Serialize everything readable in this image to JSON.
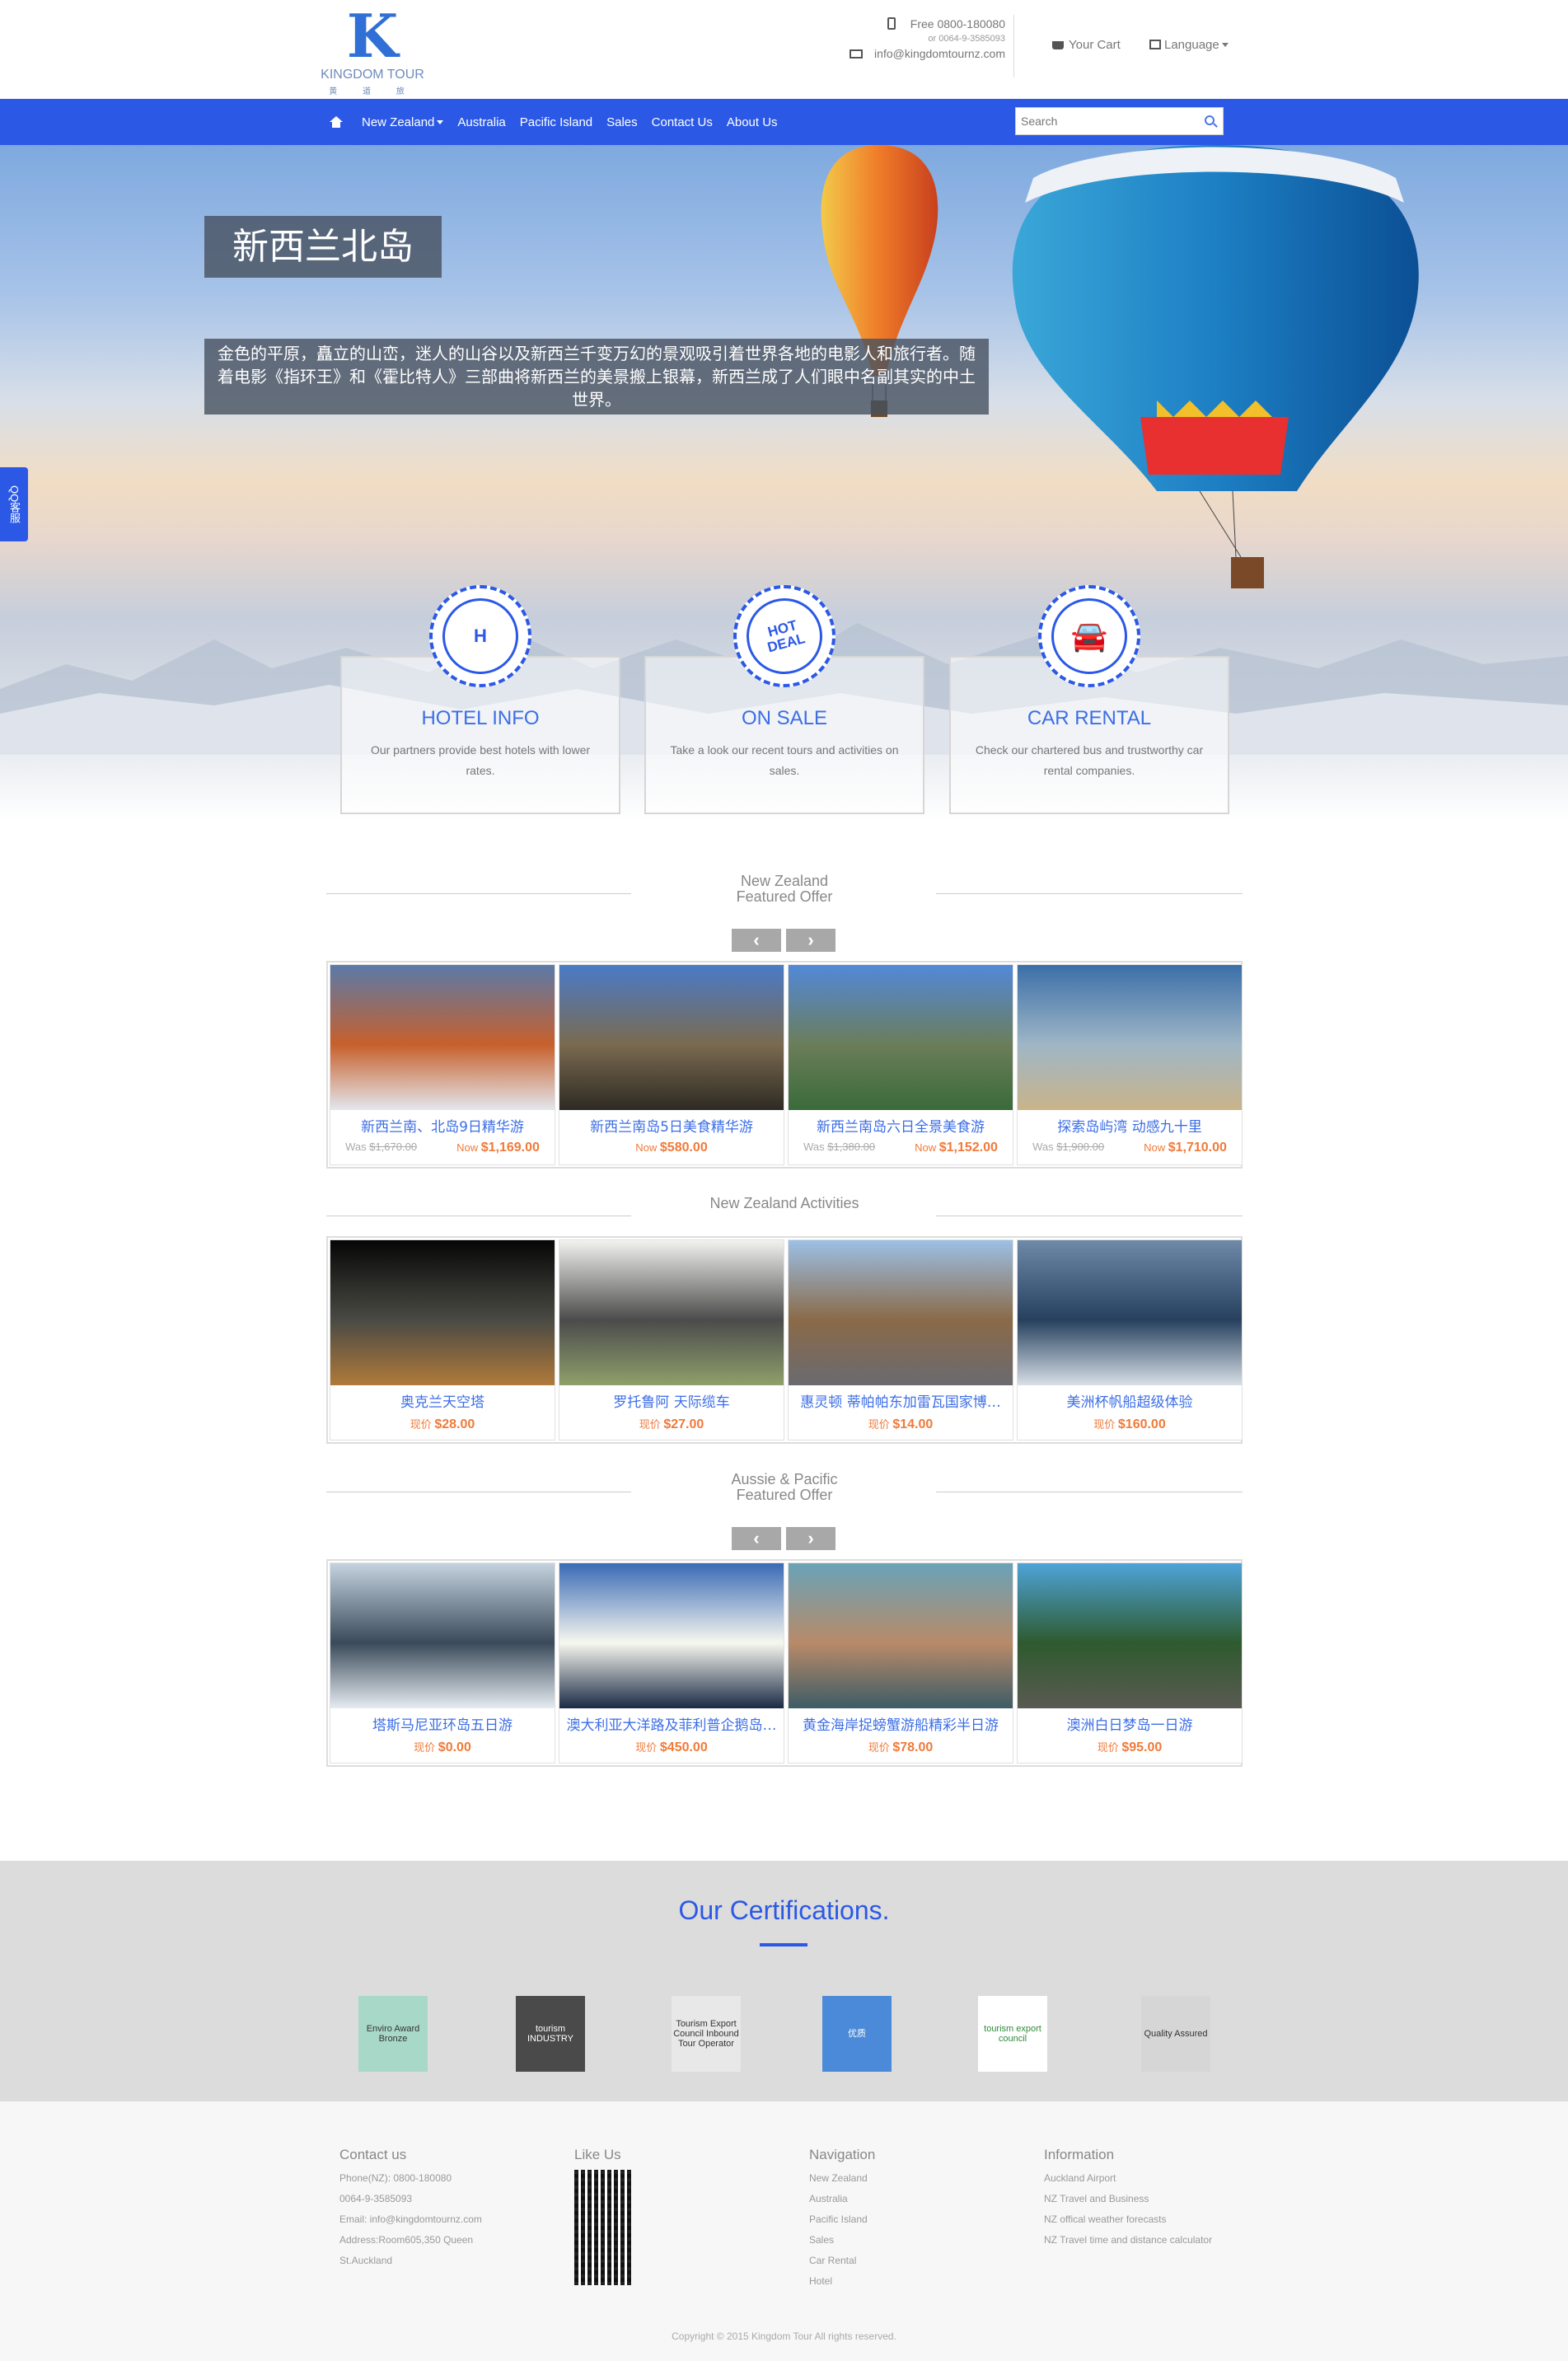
{
  "header": {
    "logo_mark": "K",
    "logo_name": "KINGDOM TOUR",
    "logo_sub": "黄 道 旅 游",
    "phone": "Free 0800-180080",
    "phone_alt": "or 0064-9-3585093",
    "email": "info@kingdomtournz.com",
    "cart": "Your Cart",
    "language": "Language"
  },
  "nav": {
    "items": [
      "New Zealand",
      "Australia",
      "Pacific Island",
      "Sales",
      "Contact Us",
      "About Us"
    ],
    "search_placeholder": "Search"
  },
  "hero": {
    "title": "新西兰北岛",
    "description": "金色的平原，矗立的山峦，迷人的山谷以及新西兰千变万幻的景观吸引着世界各地的电影人和旅行者。随着电影《指环王》和《霍比特人》三部曲将新西兰的美景搬上银幕，新西兰成了人们眼中名副其实的中土世界。",
    "qq_tab": "QQ客服"
  },
  "services": [
    {
      "icon": "hotel-icon",
      "badge": "H",
      "title": "HOTEL INFO",
      "desc": "Our partners provide best hotels with lower rates."
    },
    {
      "icon": "hot-deal-icon",
      "badge": "HOT DEAL",
      "title": "ON SALE",
      "desc": "Take a look our recent tours and activities on sales."
    },
    {
      "icon": "car-icon",
      "badge": "🚘",
      "title": "CAR RENTAL",
      "desc": "Check our chartered bus and trustworthy car rental companies."
    }
  ],
  "sections": {
    "featured_title": "New Zealand Featured Offer",
    "activities_title": "New Zealand Activities",
    "pacific_title": "Aussie & Pacific Featured Offer",
    "prev": "‹",
    "next": "›"
  },
  "featured": [
    {
      "title": "新西兰南、北岛9日精华游",
      "was": "$1,670.00",
      "now": "$1,169.00",
      "colors": [
        "#5a7aa8",
        "#c7602c",
        "#e4e7ee"
      ]
    },
    {
      "title": "新西兰南岛5日美食精华游",
      "was": "",
      "now": "$580.00",
      "colors": [
        "#4a7bc7",
        "#7a6a50",
        "#2e2a24"
      ]
    },
    {
      "title": "新西兰南岛六日全景美食游",
      "was": "$1,380.00",
      "now": "$1,152.00",
      "colors": [
        "#5289d8",
        "#6b7d5a",
        "#3a6b3a"
      ]
    },
    {
      "title": "探索岛屿湾 动感九十里",
      "was": "$1,900.00",
      "now": "$1,710.00",
      "colors": [
        "#3b6fa8",
        "#9fb6c6",
        "#c9b48a"
      ]
    }
  ],
  "activities": [
    {
      "title": "奥克兰天空塔",
      "label": "现价",
      "now": "$28.00",
      "colors": [
        "#060606",
        "#4a4a44",
        "#b07a3a"
      ]
    },
    {
      "title": "罗托鲁阿 天际缆车",
      "label": "现价",
      "now": "$27.00",
      "colors": [
        "#f2f2f0",
        "#4b4b4b",
        "#8fa06a"
      ]
    },
    {
      "title": "惠灵顿 蒂帕帕东加雷瓦国家博…",
      "label": "现价",
      "now": "$14.00",
      "colors": [
        "#9cc0e6",
        "#8a6a48",
        "#6a6a70"
      ]
    },
    {
      "title": "美洲杯帆船超级体验",
      "label": "现价",
      "now": "$160.00",
      "colors": [
        "#6e8aa8",
        "#26405e",
        "#d8dfe6"
      ]
    }
  ],
  "pacific": [
    {
      "title": "塔斯马尼亚环岛五日游",
      "label": "现价",
      "now": "$0.00",
      "colors": [
        "#c5d3e0",
        "#3a4a5a",
        "#e6ecf2"
      ]
    },
    {
      "title": "澳大利亚大洋路及菲利普企鹅岛…",
      "label": "现价",
      "now": "$450.00",
      "colors": [
        "#3a6ab5",
        "#f7f7ef",
        "#1a2a45"
      ]
    },
    {
      "title": "黄金海岸捉螃蟹游船精彩半日游",
      "label": "现价",
      "now": "$78.00",
      "colors": [
        "#6aa3b8",
        "#b88a68",
        "#3d5c66"
      ]
    },
    {
      "title": "澳洲白日梦岛一日游",
      "label": "现价",
      "now": "$95.00",
      "colors": [
        "#4ea3d8",
        "#2e5a2e",
        "#5a5a52"
      ]
    }
  ],
  "certifications": {
    "title": "Our Certifications.",
    "items": [
      {
        "label": "Enviro Award Bronze",
        "bg": "#a8d8c8",
        "fg": "#333"
      },
      {
        "label": "tourism INDUSTRY",
        "bg": "#4a4a4a",
        "fg": "#fff"
      },
      {
        "label": "Tourism Export Council Inbound Tour Operator",
        "bg": "#e8e8e8",
        "fg": "#333"
      },
      {
        "label": "优质",
        "bg": "#4a8ad8",
        "fg": "#fff"
      },
      {
        "label": "tourism export council",
        "bg": "#ffffff",
        "fg": "#2e8a3a"
      },
      {
        "label": "Quality Assured",
        "bg": "#d6d6d6",
        "fg": "#333"
      }
    ]
  },
  "footer": {
    "contact": {
      "title": "Contact us",
      "lines": [
        "Phone(NZ): 0800-180080",
        "0064-9-3585093",
        "Email: info@kingdomtournz.com",
        "Address:Room605,350 Queen",
        "St.Auckland"
      ]
    },
    "like": {
      "title": "Like Us"
    },
    "navigation": {
      "title": "Navigation",
      "lines": [
        "New Zealand",
        "Australia",
        "Pacific Island",
        "Sales",
        "Car Rental",
        "Hotel"
      ]
    },
    "information": {
      "title": "Information",
      "lines": [
        "Auckland Airport",
        "NZ Travel and Business",
        "NZ offical weather forecasts",
        "NZ Travel time and distance calculator"
      ]
    },
    "copyright": "Copyright © 2015 Kingdom Tour All rights reserved."
  }
}
